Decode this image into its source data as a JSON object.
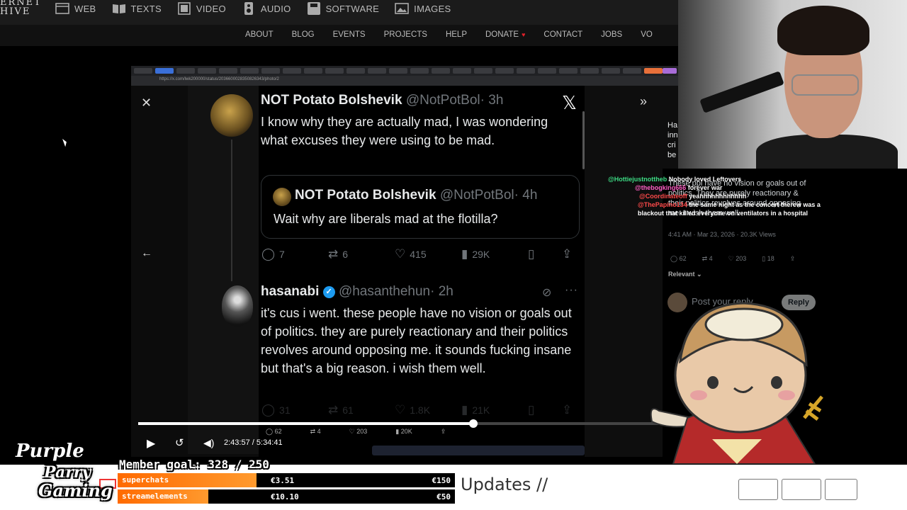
{
  "site": {
    "logo_line1": "ERNET",
    "logo_line2": "HIVE",
    "main_nav": [
      {
        "label": "WEB",
        "icon": "web-icon"
      },
      {
        "label": "TEXTS",
        "icon": "book-icon"
      },
      {
        "label": "VIDEO",
        "icon": "film-icon"
      },
      {
        "label": "AUDIO",
        "icon": "speaker-icon"
      },
      {
        "label": "SOFTWARE",
        "icon": "floppy-icon"
      },
      {
        "label": "IMAGES",
        "icon": "image-icon"
      }
    ],
    "sub_nav": [
      "ABOUT",
      "BLOG",
      "EVENTS",
      "PROJECTS",
      "HELP",
      "DONATE",
      "CONTACT",
      "JOBS",
      "VO"
    ]
  },
  "browser": {
    "url": "https://x.com/lwk200000/status/2036600028350826343/photo/2"
  },
  "tweets": {
    "main": {
      "name": "NOT Potato Bolshevik",
      "handle": "@NotPotBol",
      "time": "· 3h",
      "text": "I know why they are actually mad, I was wondering what excuses they were using to be mad."
    },
    "quoted": {
      "name": "NOT Potato Bolshevik",
      "handle": "@NotPotBol",
      "time": "· 4h",
      "text": "Wait why are liberals mad at the flotilla?"
    },
    "main_actions": {
      "replies": "7",
      "reposts": "6",
      "likes": "415",
      "views": "29K"
    },
    "reply": {
      "name": "hasanabi",
      "handle": "@hasanthehun",
      "time": "· 2h",
      "text": "it's cus i went. these people have no vision or goals out of politics. they are purely reactionary and their politics revolves around opposing me. it sounds fucking insane but that's a big reason. i wish them well."
    },
    "reply_actions": {
      "replies": "31",
      "reposts": "61",
      "likes": "1.8K",
      "views": "21K"
    }
  },
  "player": {
    "time_current": "2:43:57",
    "time_separator": "/",
    "time_total": "5:34:41",
    "progress": 0.63,
    "mini_stats": {
      "replies": "62",
      "reposts": "4",
      "likes": "203",
      "views": "20K"
    }
  },
  "right_column": {
    "text_fragments": [
      "Ha",
      "inn",
      "cri",
      "be"
    ],
    "side_text": "These ppl have no vision or goals out of politics. They are purely reactionary & their politics revolves around opposing me. I wish them well.",
    "stats": "4:41 AM · Mar 23, 2026 · 20.3K Views",
    "actions": {
      "replies": "62",
      "reposts": "4",
      "likes": "203",
      "bookmarks": "18"
    },
    "relevant": "Relevant",
    "post_placeholder": "Post your reply",
    "reply_button": "Reply"
  },
  "chat": [
    {
      "user": "@Hottiejustnottheb",
      "msg": "Nobody loved Leftovers",
      "color": "#3ddc84"
    },
    {
      "user": "@thebogking666",
      "msg": "forever war",
      "color": "#ff5ec4"
    },
    {
      "user": "@Coordinateoff",
      "msg": "yeahhhhhhhhhhhh",
      "color": "#ff4a4a"
    },
    {
      "user": "@ThePapino134",
      "msg": "the same night as the concert therew was a blackout that killed everyone on ventilators in a hospital",
      "color": "#ff4a4a"
    }
  ],
  "overlay": {
    "brand_line1": "Purple",
    "brand_line2": "Parry",
    "brand_line3": "Gaming",
    "member_goal": "Member goal: 328 / 250",
    "donations": [
      {
        "label": "superchats",
        "amount": "€3.51",
        "goal": "€150"
      },
      {
        "label": "streamelements",
        "amount": "€10.10",
        "goal": "€50"
      }
    ],
    "ghost_text": "Updates //"
  },
  "colors": {
    "x_blue": "#1d9bf0",
    "donate_heart": "#e0202a",
    "donation_orange": "#ff7a10"
  }
}
